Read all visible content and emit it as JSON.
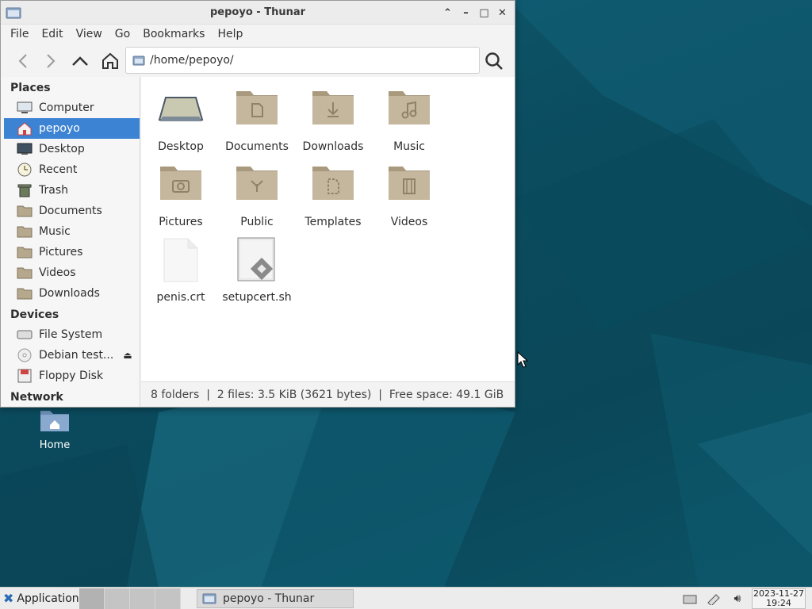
{
  "window": {
    "title": "pepoyo - Thunar",
    "menu": [
      "File",
      "Edit",
      "View",
      "Go",
      "Bookmarks",
      "Help"
    ],
    "path": "/home/pepoyo/"
  },
  "sidebar": {
    "places_heading": "Places",
    "places": [
      {
        "label": "Computer",
        "icon": "computer-icon"
      },
      {
        "label": "pepoyo",
        "icon": "home-icon",
        "active": true
      },
      {
        "label": "Desktop",
        "icon": "desktop-icon"
      },
      {
        "label": "Recent",
        "icon": "clock-icon"
      },
      {
        "label": "Trash",
        "icon": "trash-icon"
      },
      {
        "label": "Documents",
        "icon": "documents-folder-icon"
      },
      {
        "label": "Music",
        "icon": "music-folder-icon"
      },
      {
        "label": "Pictures",
        "icon": "pictures-folder-icon"
      },
      {
        "label": "Videos",
        "icon": "videos-folder-icon"
      },
      {
        "label": "Downloads",
        "icon": "downloads-folder-icon"
      }
    ],
    "devices_heading": "Devices",
    "devices": [
      {
        "label": "File System",
        "icon": "harddisk-icon"
      },
      {
        "label": "Debian test...",
        "icon": "optical-disc-icon",
        "eject": true
      },
      {
        "label": "Floppy Disk",
        "icon": "floppy-icon"
      }
    ],
    "network_heading": "Network"
  },
  "files": [
    {
      "name": "Desktop",
      "icon": "desktop-icon"
    },
    {
      "name": "Documents",
      "icon": "documents-folder-icon"
    },
    {
      "name": "Downloads",
      "icon": "downloads-folder-icon"
    },
    {
      "name": "Music",
      "icon": "music-folder-icon"
    },
    {
      "name": "Pictures",
      "icon": "pictures-folder-icon"
    },
    {
      "name": "Public",
      "icon": "public-folder-icon"
    },
    {
      "name": "Templates",
      "icon": "templates-folder-icon"
    },
    {
      "name": "Videos",
      "icon": "videos-folder-icon"
    },
    {
      "name": "penis.crt",
      "icon": "blank-file-icon"
    },
    {
      "name": "setupcert.sh",
      "icon": "script-file-icon"
    }
  ],
  "status": "8 folders  |  2 files: 3.5 KiB (3621 bytes)  |  Free space: 49.1 GiB",
  "desktop": {
    "home_label": "Home"
  },
  "taskbar": {
    "applications_label": "Applications",
    "task_label": "pepoyo - Thunar",
    "clock_date": "2023-11-27",
    "clock_time": "19:24"
  },
  "colors": {
    "accent": "#3d83d3",
    "folder": "#c2b59b",
    "desktop": "#0d4f63"
  }
}
